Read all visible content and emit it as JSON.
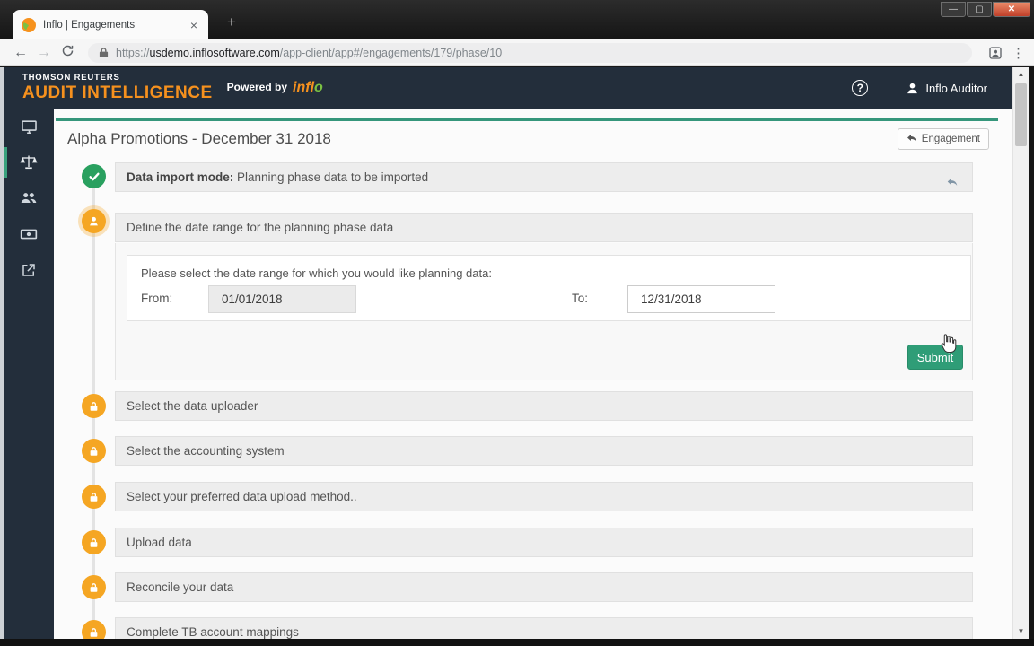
{
  "window": {
    "tab_title": "Inflo | Engagements",
    "tab_close": "×",
    "new_tab": "+",
    "controls": {
      "minimize": "—",
      "maximize": "▢",
      "close": "✕"
    }
  },
  "browser": {
    "back": "←",
    "forward": "→",
    "menu_dots": "⋮",
    "url_scheme": "https://",
    "url_domain": "usdemo.inflosoftware.com",
    "url_path": "/app-client/app#/engagements/179/phase/10"
  },
  "header": {
    "brand_top": "THOMSON REUTERS",
    "brand_main": "AUDIT INTELLIGENCE",
    "powered_by": "Powered by",
    "powered_brand_a": "infl",
    "powered_brand_o": "o",
    "help": "?",
    "user_name": "Inflo Auditor"
  },
  "page": {
    "title": "Alpha Promotions - December 31 2018",
    "engagement_button": "Engagement"
  },
  "steps": {
    "completed": {
      "label_bold": "Data import mode:",
      "label_rest": " Planning phase data to be imported"
    },
    "active": {
      "title": "Define the date range for the planning phase data",
      "prompt": "Please select the date range for which you would like planning data:",
      "from_label": "From:",
      "from_value": "01/01/2018",
      "to_label": "To:",
      "to_value": "12/31/2018",
      "submit_label": "Submit"
    },
    "locked": [
      "Select the data uploader",
      "Select the accounting system",
      "Select your preferred data upload method..",
      "Upload data",
      "Reconcile your data",
      "Complete TB account mappings"
    ]
  },
  "colors": {
    "header_navy": "#232e3b",
    "brand_orange": "#f6911e",
    "accent_teal": "#35967b",
    "step_orange": "#f5a623",
    "step_green": "#29a05f",
    "submit_green": "#2f9d77"
  }
}
